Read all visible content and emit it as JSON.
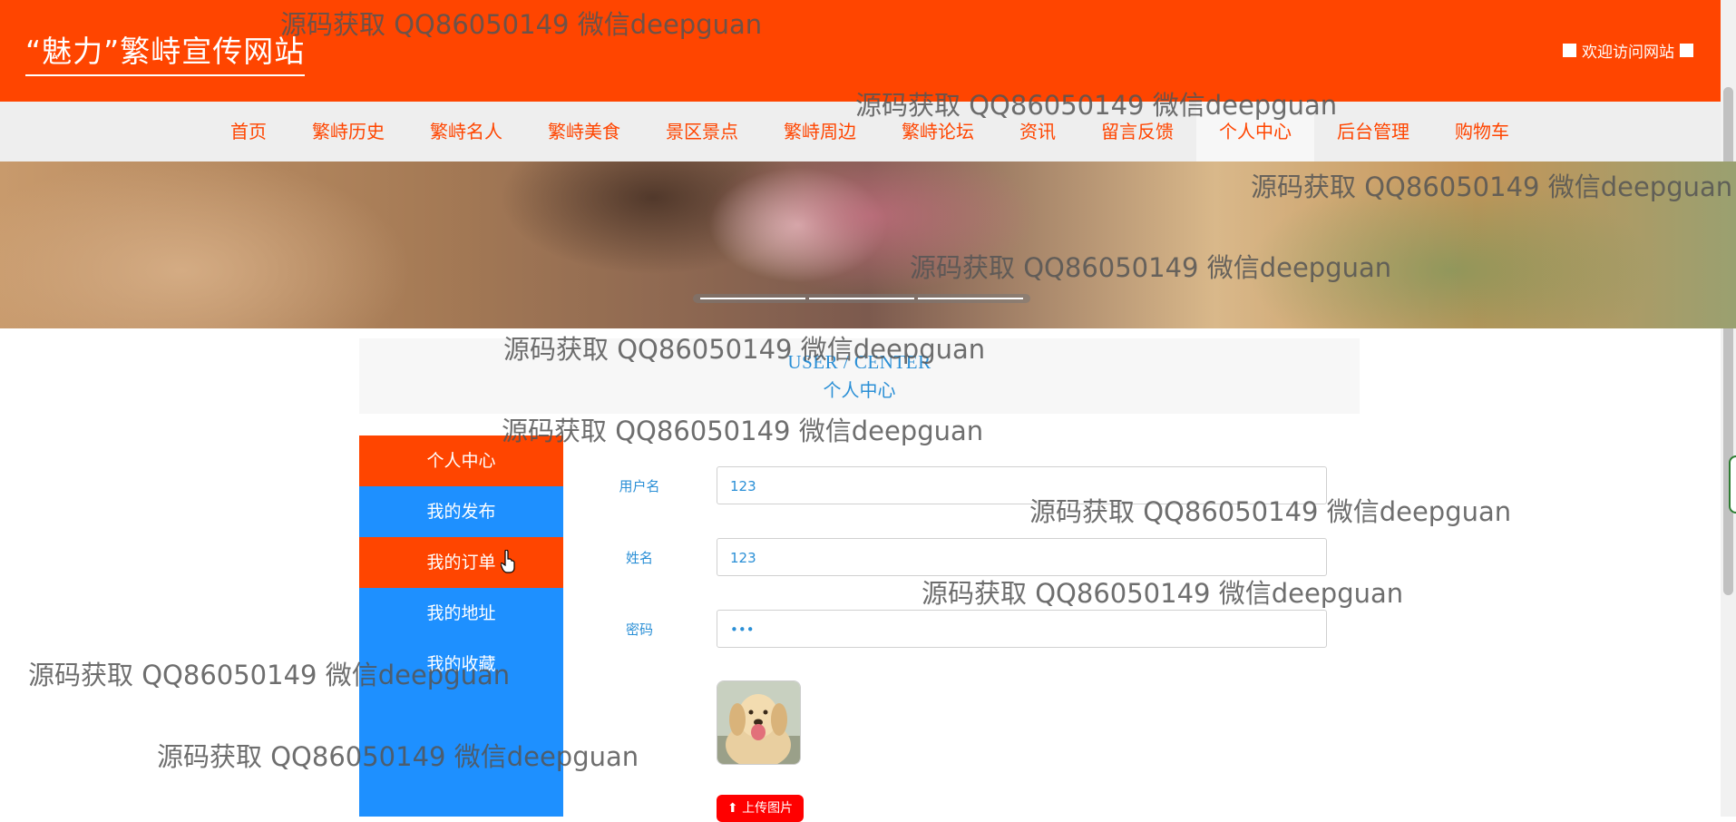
{
  "header": {
    "site_title": "“魅力”繁峙宣传网站",
    "welcome": "欢迎访问网站"
  },
  "nav": {
    "items": [
      {
        "label": "首页"
      },
      {
        "label": "繁峙历史"
      },
      {
        "label": "繁峙名人"
      },
      {
        "label": "繁峙美食"
      },
      {
        "label": "景区景点"
      },
      {
        "label": "繁峙周边"
      },
      {
        "label": "繁峙论坛"
      },
      {
        "label": "资讯"
      },
      {
        "label": "留言反馈"
      },
      {
        "label": "个人中心"
      },
      {
        "label": "后台管理"
      },
      {
        "label": "购物车"
      }
    ],
    "active": "个人中心"
  },
  "banner": {
    "slides": 3
  },
  "user_center": {
    "en_title": "USER / CENTER",
    "cn_title": "个人中心"
  },
  "side_menu": {
    "items": [
      {
        "label": "个人中心"
      },
      {
        "label": "我的发布"
      },
      {
        "label": "我的订单"
      },
      {
        "label": "我的地址"
      },
      {
        "label": "我的收藏"
      }
    ]
  },
  "form": {
    "username_label": "用户名",
    "username_value": "123",
    "name_label": "姓名",
    "name_value": "123",
    "password_label": "密码",
    "password_value": "•••",
    "upload_label": "上传图片"
  },
  "watermark": "源码获取 QQ86050149 微信deepguan",
  "colors": {
    "brand": "#ff4500",
    "side_menu": "#1e90ff",
    "label_text": "#2a8fd6"
  }
}
